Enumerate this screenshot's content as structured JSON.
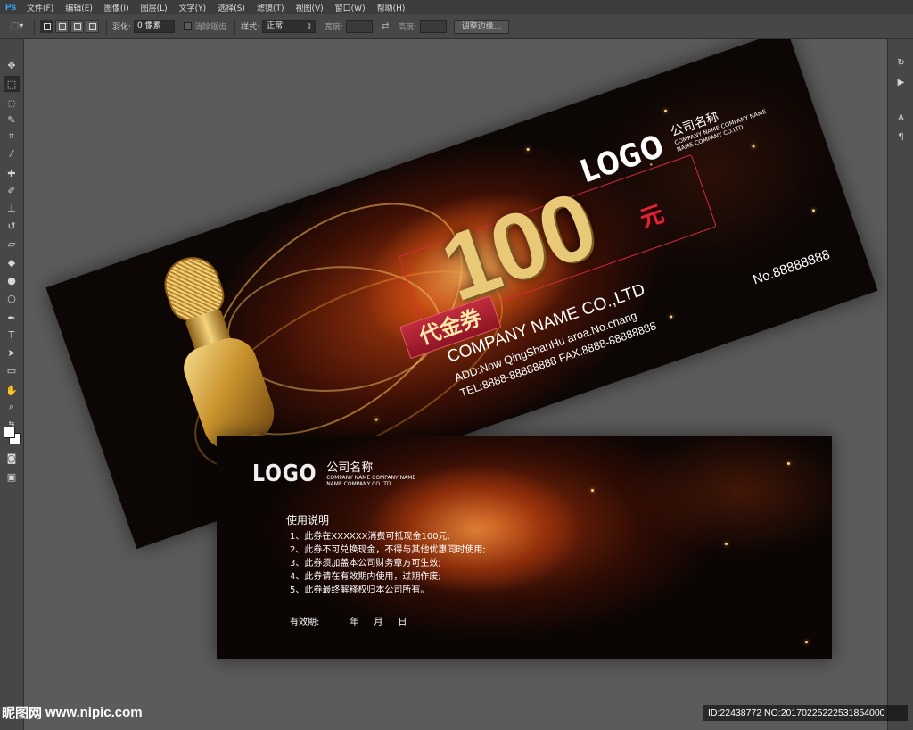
{
  "app": {
    "logo": "Ps"
  },
  "menu": {
    "items": [
      "文件(F)",
      "编辑(E)",
      "图像(I)",
      "图层(L)",
      "文字(Y)",
      "选择(S)",
      "滤镜(T)",
      "视图(V)",
      "窗口(W)",
      "帮助(H)"
    ]
  },
  "options": {
    "feather_label": "羽化:",
    "feather_value": "0 像素",
    "antialias_label": "消除锯齿",
    "style_label": "样式:",
    "style_value": "正常",
    "width_label": "宽度:",
    "height_label": "高度:",
    "refine_button": "调整边缘..."
  },
  "voucher_front": {
    "logo": "LOGO",
    "company_cn": "公司名称",
    "company_en_1": "COMPANY NAME COMPANY NAME",
    "company_en_2": "NAME COMPANY CO.LTD",
    "amount": "100",
    "currency": "元",
    "label": "代金券",
    "company": "COMPANY NAME CO.,LTD",
    "address": "ADD:Now QingShanHu aroa.No.chang",
    "tel": "TEL:8888-88888888   FAX:8888-88888888",
    "serial": "No.88888888"
  },
  "voucher_back": {
    "logo": "LOGO",
    "company_cn": "公司名称",
    "company_en_1": "COMPANY NAME COMPANY NAME",
    "company_en_2": "NAME COMPANY CO.LTD",
    "instructions_title": "使用说明",
    "instructions": [
      "1、此券在XXXXXX消费可抵现金100元;",
      "2、此券不可兑换现金，不得与其他优惠同时使用;",
      "3、此券须加盖本公司财务章方可生效;",
      "4、此券请在有效期内使用，过期作废;",
      "5、此券最终解释权归本公司所有。"
    ],
    "validity_label": "有效期:",
    "year": "年",
    "month": "月",
    "day": "日"
  },
  "watermark": {
    "site_cn": "昵图网",
    "site_url": "www.nipic.com",
    "id_text": "ID:22438772 NO:20170225222531854000"
  },
  "colors": {
    "ps_blue": "#31a8ff",
    "gold": "#e9c877",
    "red": "#e52235"
  }
}
